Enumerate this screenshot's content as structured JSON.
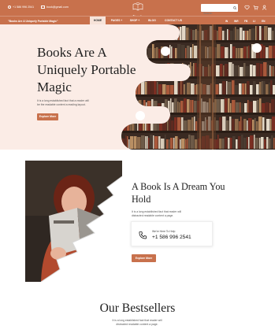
{
  "header": {
    "phone": "+1 586 996 2541",
    "email": "book@gmail.com",
    "logo_text": "Novels",
    "search_placeholder": "Search",
    "promo": "\"Books Are A Uniquely Portable Magic\"",
    "menu": [
      {
        "label": "HOME",
        "active": true
      },
      {
        "label": "PAGES +"
      },
      {
        "label": "SHOP +"
      },
      {
        "label": "BLOG"
      },
      {
        "label": "CONTACT US"
      }
    ],
    "utility": [
      "IN",
      "INR",
      "FB",
      "LI",
      "EN"
    ]
  },
  "hero": {
    "title": "Books Are A Uniquely Portable Magic",
    "subtitle": "It is a long established fact that a reader will be the readable content a reading layout.",
    "button": "Explore More"
  },
  "about": {
    "title": "A Book Is A Dream You Hold",
    "subtitle": "It is a long established fact that reader will distracted readable content a page.",
    "help_label": "We're Here To Help",
    "help_phone": "+1 586 996 2541",
    "button": "Explore More"
  },
  "bestsellers": {
    "title": "Our Bestsellers",
    "subtitle": "It is a long established fact that reader will distracted readable content a page."
  },
  "colors": {
    "accent": "#c8714c",
    "hero_bg": "#fbece6",
    "dark": "#3a2a22"
  },
  "icons": [
    "phone-icon",
    "email-icon",
    "logo-book-icon",
    "search-icon",
    "heart-icon",
    "cart-icon",
    "user-icon"
  ]
}
